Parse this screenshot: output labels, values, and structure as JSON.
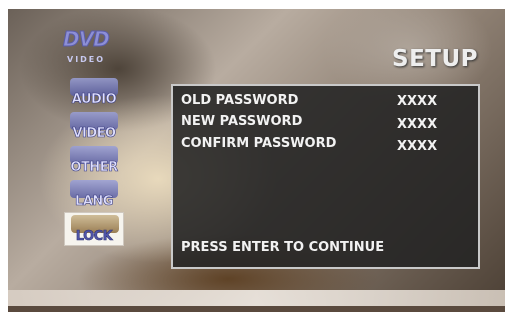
{
  "logo": {
    "main": "DVD",
    "sub": "VIDEO"
  },
  "title": "SETUP",
  "menu": [
    {
      "label": "AUDIO",
      "icon": "speaker-icon",
      "active": false
    },
    {
      "label": "VIDEO",
      "icon": "tv-icon",
      "active": false
    },
    {
      "label": "OTHER",
      "icon": "other-icon",
      "active": false
    },
    {
      "label": "LANG",
      "icon": "language-icon",
      "active": false
    },
    {
      "label": "LOCK",
      "icon": "lock-icon",
      "active": true
    }
  ],
  "panel": {
    "rows": [
      {
        "label": "OLD PASSWORD",
        "value": "XXXX"
      },
      {
        "label": "NEW PASSWORD",
        "value": "XXXX"
      },
      {
        "label": "CONFIRM PASSWORD",
        "value": "XXXX"
      }
    ],
    "prompt": "PRESS ENTER TO CONTINUE"
  }
}
